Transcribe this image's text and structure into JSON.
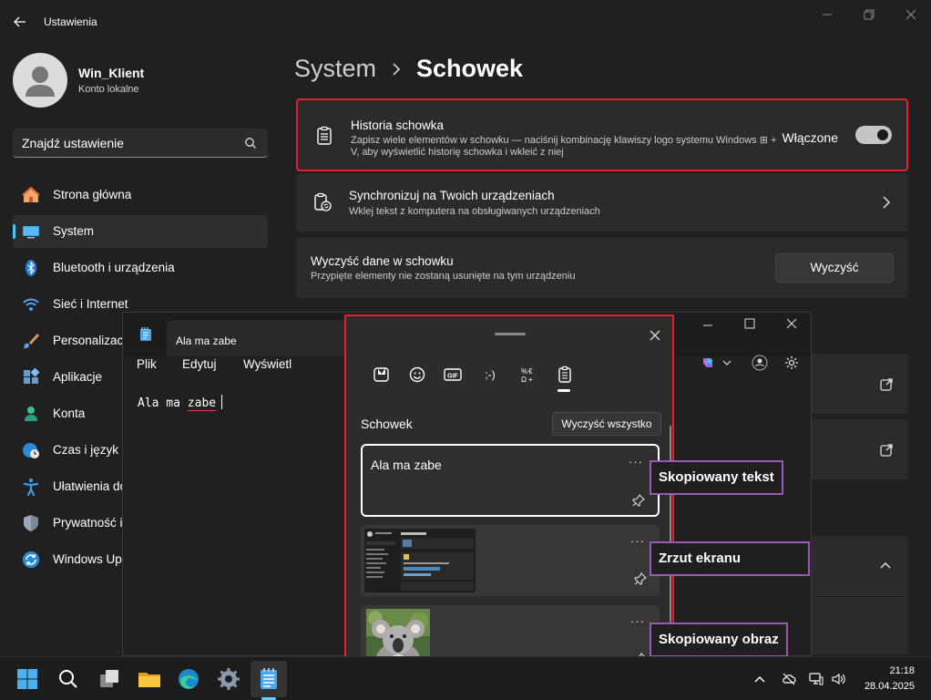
{
  "settings": {
    "app_title": "Ustawienia",
    "user": {
      "name": "Win_Klient",
      "account_type": "Konto lokalne"
    },
    "search": {
      "placeholder": "Znajdź ustawienie"
    },
    "nav": [
      {
        "label": "Strona główna",
        "icon": "home-icon"
      },
      {
        "label": "System",
        "icon": "monitor-icon",
        "active": true
      },
      {
        "label": "Bluetooth i urządzenia",
        "icon": "bluetooth-icon"
      },
      {
        "label": "Sieć i Internet",
        "icon": "wifi-icon"
      },
      {
        "label": "Personalizacja",
        "icon": "brush-icon"
      },
      {
        "label": "Aplikacje",
        "icon": "apps-icon"
      },
      {
        "label": "Konta",
        "icon": "person-icon"
      },
      {
        "label": "Czas i język",
        "icon": "globe-clock-icon"
      },
      {
        "label": "Ułatwienia dostępu",
        "icon": "accessibility-icon"
      },
      {
        "label": "Prywatność i zabezpieczenia",
        "icon": "shield-icon"
      },
      {
        "label": "Windows Update",
        "icon": "update-icon"
      }
    ],
    "breadcrumb": {
      "root": "System",
      "current": "Schowek"
    },
    "history": {
      "title": "Historia schowka",
      "description": "Zapisz wiele elementów w schowku — naciśnij kombinację klawiszy logo systemu Windows ⊞ + V, aby wyświetlić historię schowka i wkleić z niej",
      "toggle_label": "Włączone",
      "toggle_on": true
    },
    "sync": {
      "title": "Synchronizuj na Twoich urządzeniach",
      "description": "Wklej tekst z komputera na obsługiwanych urządzeniach"
    },
    "clear": {
      "title": "Wyczyść dane w schowku",
      "description": "Przypięte elementy nie zostaną usunięte na tym urządzeniu",
      "button": "Wyczyść"
    }
  },
  "notepad": {
    "tab_title": "Ala ma zabe",
    "menu": [
      "Plik",
      "Edytuj",
      "Wyświetl"
    ],
    "content": {
      "before": "Ala ma ",
      "misspelled": "zabe"
    }
  },
  "clipboard_panel": {
    "tabs": [
      "sticker-icon",
      "emoji-icon",
      "gif-icon",
      "kaomoji-icon",
      "symbols-icon",
      "clipboard-icon"
    ],
    "active_tab": "clipboard-icon",
    "heading": "Schowek",
    "clear_all": "Wyczyść wszystko",
    "items": [
      {
        "type": "text",
        "text": "Ala ma zabe",
        "more": "···"
      },
      {
        "type": "screenshot",
        "more": "···"
      },
      {
        "type": "image",
        "more": "···"
      }
    ]
  },
  "callouts": [
    "Skopiowany tekst",
    "Zrzut ekranu",
    "Skopiowany obraz"
  ],
  "taskbar": {
    "apps": [
      "windows-start-icon",
      "search-icon",
      "task-view-icon",
      "file-explorer-icon",
      "edge-icon",
      "settings-icon",
      "notepad-icon"
    ],
    "time": "21:18",
    "date": "28.04.2025"
  },
  "colors": {
    "accent": "#4cc2ff",
    "highlight_red": "#e5202b",
    "callout_purple": "#9b59b6"
  }
}
